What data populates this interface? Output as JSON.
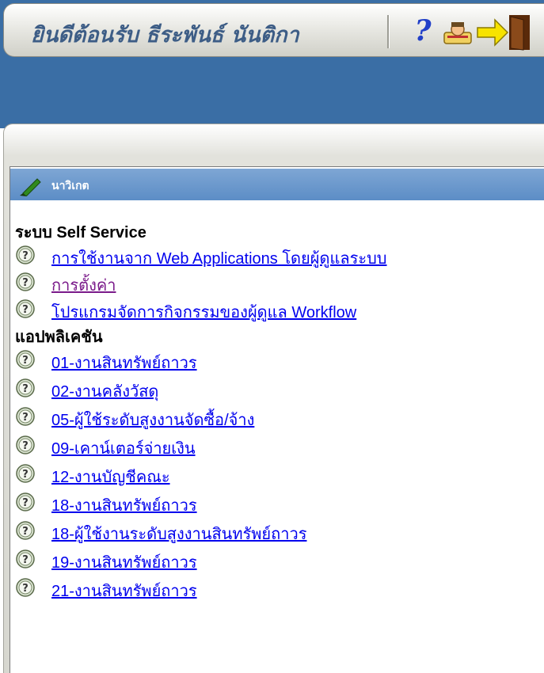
{
  "header": {
    "welcome_text": "ยินดีต้อนรับ ธีระพันธ์ นันติกา",
    "icons": [
      "help-icon",
      "user-icon",
      "logout-icon"
    ]
  },
  "navigator": {
    "title": "นาวิเกต",
    "sections": [
      {
        "title": "ระบบ Self Service",
        "items": [
          {
            "label": "การใช้งานจาก Web Applications โดยผู้ดูแลระบบ",
            "visited": false
          },
          {
            "label": "การตั้งค่า",
            "visited": true
          },
          {
            "label": "โปรแกรมจัดการกิจกรรมของผู้ดูแล Workflow",
            "visited": false
          }
        ]
      },
      {
        "title": "แอปพลิเคชัน",
        "items": [
          {
            "label": "01-งานสินทรัพย์ถาวร",
            "visited": false
          },
          {
            "label": "02-งานคลังวัสดุ",
            "visited": false
          },
          {
            "label": "05-ผู้ใช้ระดับสูงงานจัดซื้อ/จ้าง",
            "visited": false
          },
          {
            "label": "09-เคาน์เตอร์จ่ายเงิน",
            "visited": false
          },
          {
            "label": "12-งานบัญชีคณะ",
            "visited": false
          },
          {
            "label": "18-งานสินทรัพย์ถาวร",
            "visited": false
          },
          {
            "label": "18-ผู้ใช้งานระดับสูงงานสินทรัพย์ถาวร",
            "visited": false
          },
          {
            "label": "19-งานสินทรัพย์ถาวร",
            "visited": false
          },
          {
            "label": "21-งานสินทรัพย์ถาวร",
            "visited": false
          }
        ]
      }
    ]
  },
  "colors": {
    "header_blue": "#3a6ea5",
    "welcome_text": "#3d5d86",
    "nav_header": "#6894cb",
    "link": "#0000ee",
    "visited_link": "#7a1a8a"
  }
}
